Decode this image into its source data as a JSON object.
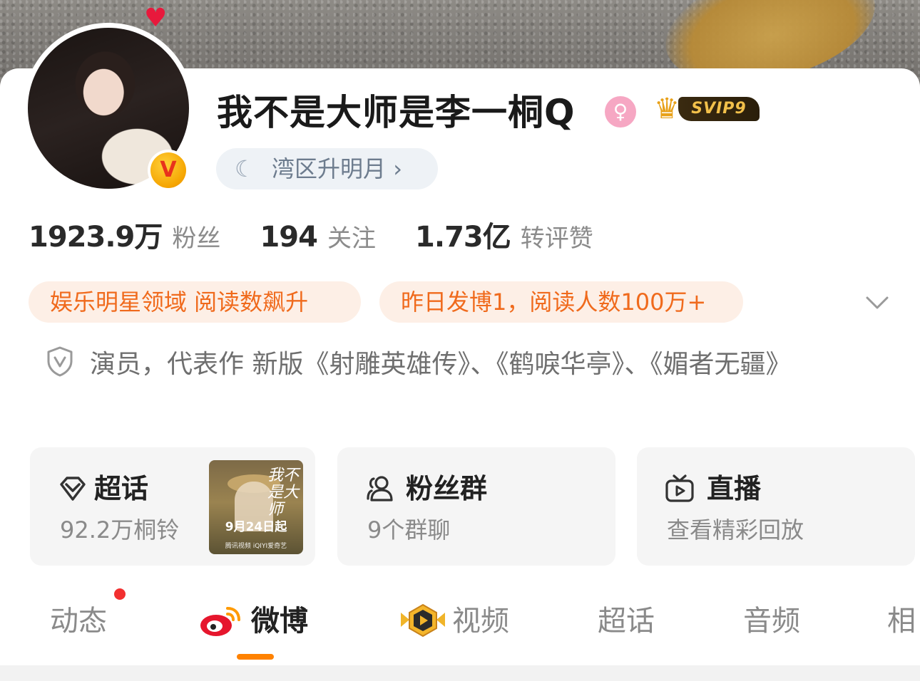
{
  "profile": {
    "name": "我不是大师是李一桐Q",
    "gender_symbol": "♀",
    "vip_label": "SVIP9",
    "verified_mark": "V",
    "location_label": "湾区升明月",
    "location_chevron": "›"
  },
  "stats": [
    {
      "value": "1923.9万",
      "label": "粉丝"
    },
    {
      "value": "194",
      "label": "关注"
    },
    {
      "value": "1.73亿",
      "label": "转评赞"
    }
  ],
  "chips": [
    "娱乐明星领域 阅读数飙升",
    "昨日发博1，阅读人数100万+"
  ],
  "intro": "演员，代表作 新版《射雕英雄传》、《鹤唳华亭》、《媚者无疆》",
  "entries": [
    {
      "title": "超话",
      "subtitle": "92.2万桐铃",
      "icon": "supertopic-icon"
    },
    {
      "title": "粉丝群",
      "subtitle": "9个群聊",
      "icon": "fans-group-icon"
    },
    {
      "title": "直播",
      "subtitle": "查看精彩回放",
      "icon": "live-tv-icon"
    }
  ],
  "poster": {
    "title": "我不是大师",
    "date": "9月24日起",
    "platforms": "腾讯视频 iQIYI爱奇艺"
  },
  "tabs": [
    "动态",
    "微博",
    "视频",
    "超话",
    "音频",
    "相"
  ],
  "active_tab": "微博",
  "colors": {
    "accent": "#ff8200",
    "chip_text": "#f06a1c",
    "chip_bg": "#fdefe6",
    "notification_dot": "#f23030"
  }
}
